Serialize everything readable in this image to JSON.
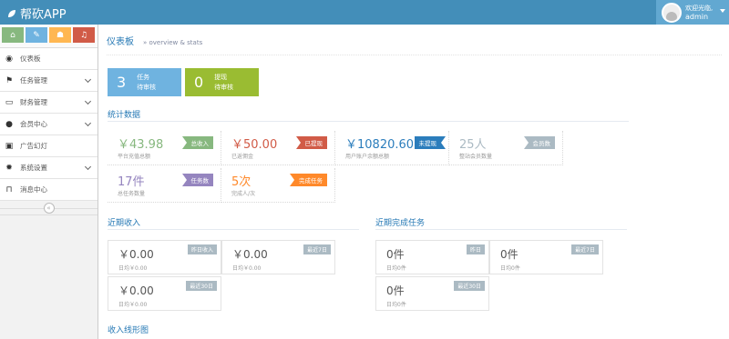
{
  "app": {
    "title": "帮砍APP"
  },
  "user": {
    "greeting": "欢迎光临,",
    "name": "admin"
  },
  "sidebar": {
    "items": [
      {
        "label": "仪表板",
        "icon": "dashboard-icon",
        "glyph": "◉"
      },
      {
        "label": "任务管理",
        "icon": "flag-icon",
        "glyph": "⚑"
      },
      {
        "label": "财务管理",
        "icon": "inbox-icon",
        "glyph": "▭"
      },
      {
        "label": "会员中心",
        "icon": "user-icon",
        "glyph": "●"
      },
      {
        "label": "广告幻灯",
        "icon": "picture-icon",
        "glyph": "▣"
      },
      {
        "label": "系统设置",
        "icon": "gear-icon",
        "glyph": "✹"
      },
      {
        "label": "消息中心",
        "icon": "bookmark-icon",
        "glyph": "⊓"
      }
    ]
  },
  "page": {
    "title": "仪表板",
    "subtitle": "» overview & stats"
  },
  "pending": [
    {
      "count": "3",
      "line1": "任务",
      "line2": "待审核",
      "color": "#6fb3e0"
    },
    {
      "count": "0",
      "line1": "提现",
      "line2": "待审核",
      "color": "#9abc32"
    }
  ],
  "stats_title": "统计数据",
  "stats": [
    {
      "value": "￥43.98",
      "desc": "平台充值总额",
      "tag": "总收入",
      "color": "#87b87f"
    },
    {
      "value": "￥50.00",
      "desc": "已返佣金",
      "tag": "已提现",
      "color": "#d15b47"
    },
    {
      "value": "￥10820.60",
      "desc": "用户账户余额总额",
      "tag": "未提现",
      "color": "#2b7dbc"
    },
    {
      "value": "25人",
      "desc": "整站会员数量",
      "tag": "会员数",
      "color": "#abbac3"
    },
    {
      "value": "17件",
      "desc": "总任务数量",
      "tag": "任务数",
      "color": "#9585bf"
    },
    {
      "value": "5次",
      "desc": "完成人/次",
      "tag": "完成任务",
      "color": "#ff892a"
    }
  ],
  "income": {
    "title": "近期收入",
    "boxes": [
      {
        "value": "￥0.00",
        "desc": "日均￥0.00",
        "tag": "昨日收入"
      },
      {
        "value": "￥0.00",
        "desc": "日均￥0.00",
        "tag": "最近7日"
      },
      {
        "value": "￥0.00",
        "desc": "日均￥0.00",
        "tag": "最近30日"
      }
    ]
  },
  "tasks": {
    "title": "近期完成任务",
    "boxes": [
      {
        "value": "0件",
        "desc": "日均0件",
        "tag": "昨日"
      },
      {
        "value": "0件",
        "desc": "日均0件",
        "tag": "最近7日"
      },
      {
        "value": "0件",
        "desc": "日均0件",
        "tag": "最近30日"
      }
    ]
  },
  "chart_section": {
    "title": "收入线形图"
  }
}
